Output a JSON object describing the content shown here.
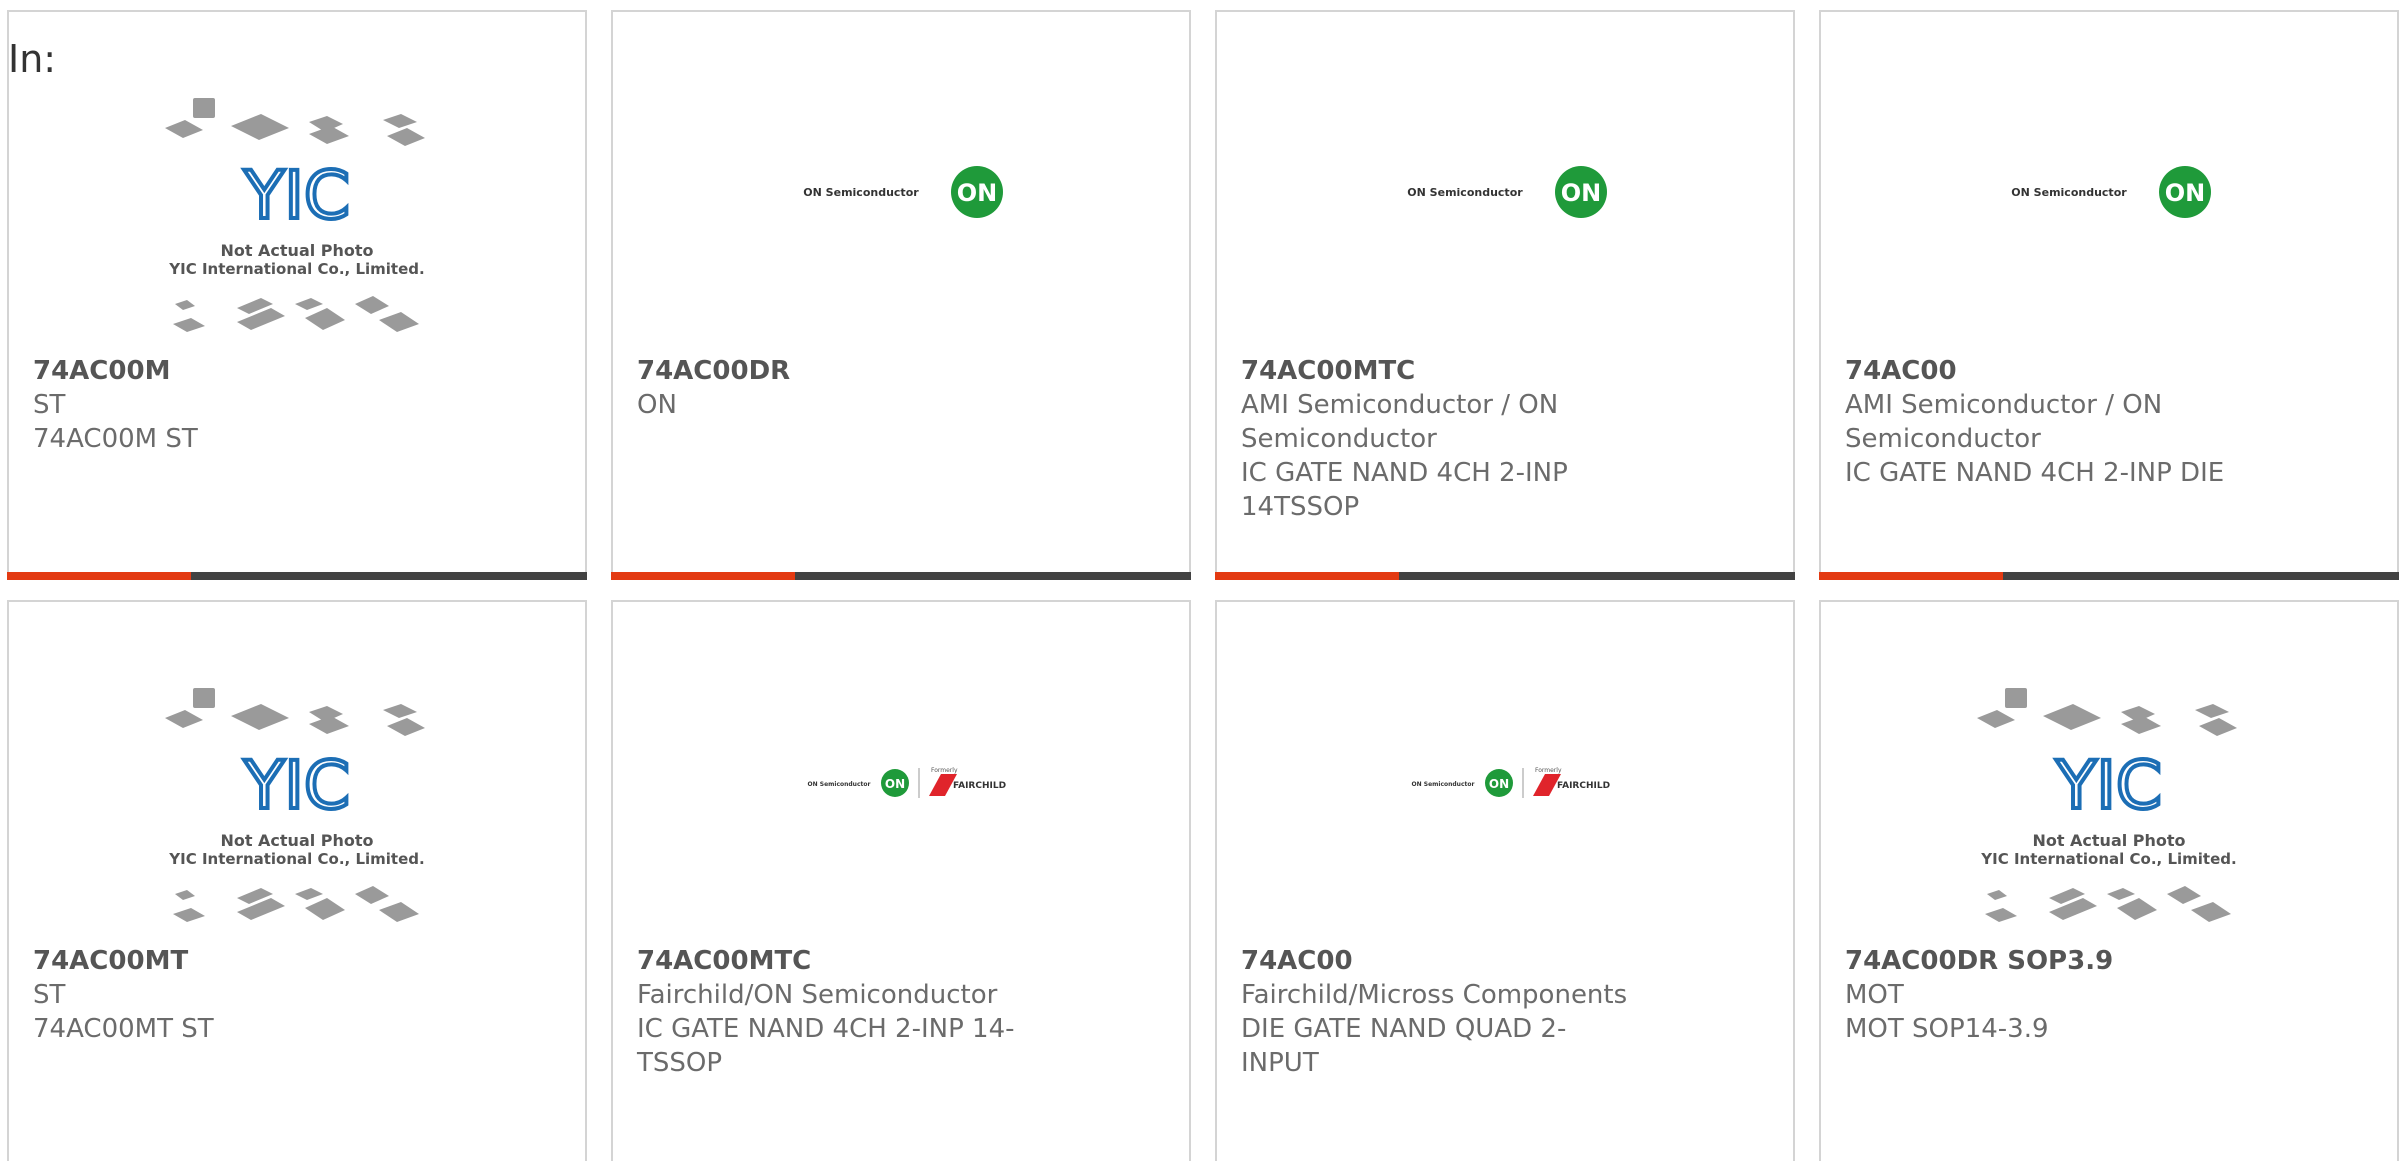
{
  "filter_label": "In:",
  "placeholder": {
    "line1": "Not Actual Photo",
    "line2": "YIC International Co., Limited.",
    "logo_text": "YIC"
  },
  "on_logo": {
    "wordmark": "ON Semiconductor",
    "badge": "ON",
    "formerly": "Formerly",
    "fairchild": "FAIRCHILD"
  },
  "accent_colors": {
    "bar": "#424242",
    "accent": "#e33a12",
    "on_green": "#1f9a3a",
    "yic_blue": "#1c6eb5"
  },
  "products": [
    {
      "part": "74AC00M",
      "brand": "ST",
      "desc": "74AC00M ST",
      "image": "yic-placeholder"
    },
    {
      "part": "74AC00DR",
      "brand": "ON",
      "desc": "",
      "image": "on-semiconductor-logo"
    },
    {
      "part": "74AC00MTC",
      "brand": "AMI Semiconductor / ON Semiconductor",
      "desc": "IC GATE NAND 4CH 2-INP 14TSSOP",
      "image": "on-semiconductor-logo"
    },
    {
      "part": "74AC00",
      "brand": "AMI Semiconductor / ON Semiconductor",
      "desc": "IC GATE NAND 4CH 2-INP DIE",
      "image": "on-semiconductor-logo"
    },
    {
      "part": "74AC00MT",
      "brand": "ST",
      "desc": "74AC00MT ST",
      "image": "yic-placeholder"
    },
    {
      "part": "74AC00MTC",
      "brand": "Fairchild/ON Semiconductor",
      "desc": "IC GATE NAND 4CH 2-INP 14-TSSOP",
      "image": "on-fairchild-logo"
    },
    {
      "part": "74AC00",
      "brand": "Fairchild/Micross Components",
      "desc": "DIE GATE NAND QUAD 2-INPUT",
      "image": "on-fairchild-logo"
    },
    {
      "part": "74AC00DR SOP3.9",
      "brand": "MOT",
      "desc": "MOT SOP14-3.9",
      "image": "yic-placeholder"
    }
  ]
}
